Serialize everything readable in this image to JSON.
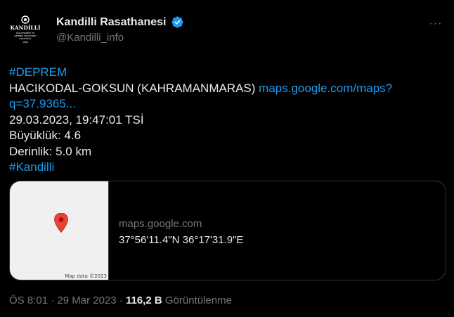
{
  "author": {
    "display_name": "Kandilli Rasathanesi",
    "handle": "@Kandilli_info",
    "verified_color": "#1d9bf0",
    "avatar_icon": "kandilli-logo-icon",
    "avatar_lines": [
      "KANDİLLİ",
      "RASATHANESİ VE",
      "DEPREM ARAŞTIRMA",
      "ENSTİTÜSÜ",
      "1868"
    ]
  },
  "tweet": {
    "hashtag1": "#DEPREM",
    "location": "HACIKODAL-GOKSUN (KAHRAMANMARAS) ",
    "link_text": "maps.google.com/maps?q=37.9365...",
    "datetime": "29.03.2023, 19:47:01 TSİ",
    "magnitude": "Büyüklük: 4.6",
    "depth": "Derinlik: 5.0 km",
    "hashtag2": "#Kandilli"
  },
  "card": {
    "domain": "maps.google.com",
    "title": "37°56'11.4\"N 36°17'31.9\"E",
    "map_attribution": "Map data ©2023"
  },
  "meta": {
    "time": "ÖS 8:01",
    "separator": " · ",
    "date": "29 Mar 2023",
    "views_count": "116,2 B",
    "views_label": " Görüntülenme"
  },
  "more_label": "···",
  "colors": {
    "accent": "#1d9bf0",
    "text": "#e7e9ea",
    "muted": "#71767b",
    "border": "#2f3336",
    "pin": "#ea4335"
  }
}
